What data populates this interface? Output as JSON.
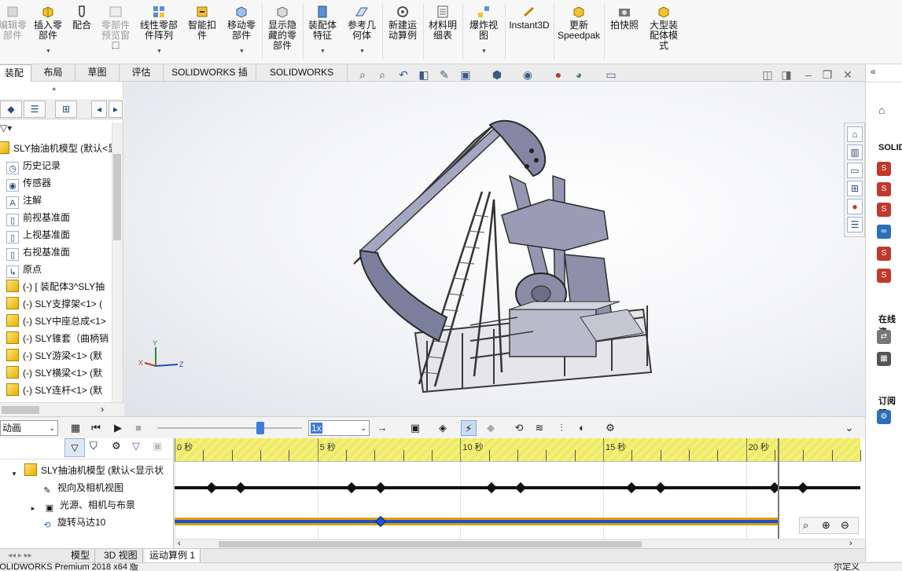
{
  "ribbon": {
    "buttons": [
      {
        "label": "编辑零\n部件",
        "disabled": true
      },
      {
        "label": "插入零\n部件",
        "disabled": false
      },
      {
        "label": "配合",
        "disabled": false
      },
      {
        "label": "零部件\n预览窗\n口",
        "disabled": true
      },
      {
        "label": "线性零部\n件阵列",
        "disabled": false
      },
      {
        "label": "智能扣\n件",
        "disabled": false
      },
      {
        "label": "移动零\n部件",
        "disabled": false
      },
      {
        "label": "显示隐\n藏的零\n部件",
        "disabled": false
      },
      {
        "label": "装配体\n特征",
        "disabled": false
      },
      {
        "label": "参考几\n何体",
        "disabled": false
      },
      {
        "label": "新建运\n动算例",
        "disabled": false
      },
      {
        "label": "材料明\n细表",
        "disabled": false
      },
      {
        "label": "爆炸视\n图",
        "disabled": false
      },
      {
        "label": "Instant3D",
        "disabled": false
      },
      {
        "label": "更新\nSpeedpak",
        "disabled": false
      },
      {
        "label": "拍快照",
        "disabled": false
      },
      {
        "label": "大型装\n配体模\n式",
        "disabled": false
      }
    ]
  },
  "tabs": [
    "装配体",
    "布局",
    "草图",
    "评估",
    "SOLIDWORKS 插件",
    "SOLIDWORKS MBD"
  ],
  "feature_tree": {
    "root": "SLY抽油机模型  (默认<显",
    "items": [
      {
        "label": "历史记录",
        "icon": "history-icon"
      },
      {
        "label": "传感器",
        "icon": "sensor-icon"
      },
      {
        "label": "注解",
        "icon": "annotation-icon"
      },
      {
        "label": "前视基准面",
        "icon": "plane-icon"
      },
      {
        "label": "上视基准面",
        "icon": "plane-icon"
      },
      {
        "label": "右视基准面",
        "icon": "plane-icon"
      },
      {
        "label": "原点",
        "icon": "origin-icon"
      },
      {
        "label": "(-) [ 装配体3^SLY抽",
        "icon": "subassembly-icon"
      },
      {
        "label": "(-) SLY支撑架<1> (",
        "icon": "part-icon"
      },
      {
        "label": "(-) SLY中座总成<1>",
        "icon": "part-icon"
      },
      {
        "label": "(-) SLY锥套（曲柄销",
        "icon": "part-icon"
      },
      {
        "label": "(-) SLY游梁<1> (默",
        "icon": "part-icon"
      },
      {
        "label": "(-) SLY横梁<1> (默",
        "icon": "part-icon"
      },
      {
        "label": "(-) SLY连杆<1> (默",
        "icon": "part-icon"
      }
    ]
  },
  "triad": {
    "x": "X",
    "y": "Y",
    "z": "Z"
  },
  "animation": {
    "study_type": "动画",
    "speed": "1x"
  },
  "motion_tree": {
    "root": "SLY抽油机模型  (默认<显示状",
    "items": [
      "视向及相机视图",
      "光源、相机与布景",
      "旋转马达10"
    ]
  },
  "timeline": {
    "labels": [
      "0 秒",
      "5 秒",
      "10 秒",
      "15 秒",
      "20 秒"
    ],
    "major_seconds": [
      0,
      5,
      10,
      15,
      20
    ],
    "max_seconds": 24,
    "current_time": 21.1,
    "view_keys": [
      1.3,
      2.3,
      6.2,
      7.2,
      11.1,
      12.1,
      16.0,
      17.0,
      21.0,
      22.0
    ],
    "motor_keys": [
      7.2
    ]
  },
  "bottom_tabs": [
    "模型",
    "3D 视图",
    "运动算例 1"
  ],
  "status": {
    "left": "SOLIDWORKS Premium 2018 x64 版",
    "right": "尔定义"
  },
  "right_panel": {
    "section1": "SOLID",
    "section2": "在线资",
    "section3": "订阅服"
  }
}
